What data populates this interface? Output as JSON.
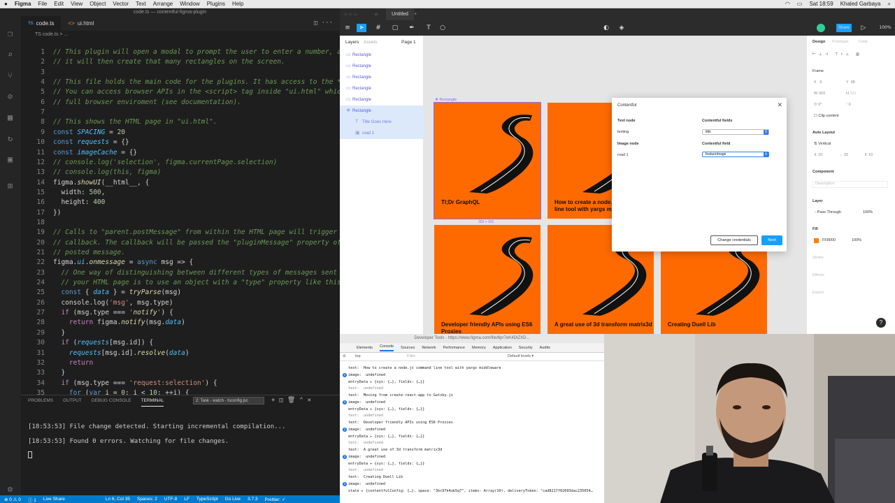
{
  "menubar": {
    "app": "Figma",
    "items": [
      "File",
      "Edit",
      "View",
      "Object",
      "Vector",
      "Text",
      "Arrange",
      "Window",
      "Plugins",
      "Help"
    ],
    "clock": "Sat 18:59",
    "user": "Khaled Garbaya"
  },
  "vscode": {
    "window_title": "code.ts — contentful-figma-plugin",
    "tabs": [
      {
        "badge": "TS",
        "label": "code.ts"
      },
      {
        "badge": "<>",
        "label": "ui.html"
      }
    ],
    "breadcrumb": "TS code.ts > ...",
    "code_lines": [
      {
        "n": "1",
        "t": "// This plugin will open a modal to prompt the user to enter a number, and"
      },
      {
        "n": "2",
        "t": "// it will then create that many rectangles on the screen."
      },
      {
        "n": "3",
        "t": ""
      },
      {
        "n": "4",
        "t": "// This file holds the main code for the plugins. It has access to the *doc"
      },
      {
        "n": "5",
        "t": "// You can access browser APIs in the <script> tag inside \"ui.html\" which"
      },
      {
        "n": "6",
        "t": "// full browser enviroment (see documentation)."
      },
      {
        "n": "7",
        "t": ""
      },
      {
        "n": "8",
        "t": "// This shows the HTML page in \"ui.html\"."
      },
      {
        "n": "9",
        "t": "const SPACING = 20"
      },
      {
        "n": "10",
        "t": "const requests = {}"
      },
      {
        "n": "11",
        "t": "const imageCache = {}"
      },
      {
        "n": "12",
        "t": "// console.log('selection', figma.currentPage.selection)"
      },
      {
        "n": "13",
        "t": "// console.log(this, figma)"
      },
      {
        "n": "14",
        "t": "figma.showUI(__html__, {"
      },
      {
        "n": "15",
        "t": "  width: 500,"
      },
      {
        "n": "16",
        "t": "  height: 400"
      },
      {
        "n": "17",
        "t": "})"
      },
      {
        "n": "18",
        "t": ""
      },
      {
        "n": "19",
        "t": "// Calls to \"parent.postMessage\" from within the HTML page will trigger th"
      },
      {
        "n": "20",
        "t": "// callback. The callback will be passed the \"pluginMessage\" property of"
      },
      {
        "n": "21",
        "t": "// posted message."
      },
      {
        "n": "22",
        "t": "figma.ui.onmessage = async msg => {"
      },
      {
        "n": "23",
        "t": "  // One way of distinguishing between different types of messages sent"
      },
      {
        "n": "24",
        "t": "  // your HTML page is to use an object with a \"type\" property like this"
      },
      {
        "n": "25",
        "t": "  const { data } = tryParse(msg)"
      },
      {
        "n": "26",
        "t": "  console.log('msg', msg.type)"
      },
      {
        "n": "27",
        "t": "  if (msg.type === 'notify') {"
      },
      {
        "n": "28",
        "t": "    return figma.notify(msg.data)"
      },
      {
        "n": "29",
        "t": "  }"
      },
      {
        "n": "30",
        "t": "  if (requests[msg.id]) {"
      },
      {
        "n": "31",
        "t": "    requests[msg.id].resolve(data)"
      },
      {
        "n": "32",
        "t": "    return"
      },
      {
        "n": "33",
        "t": "  }"
      },
      {
        "n": "34",
        "t": "  if (msg.type === 'request:selection') {"
      },
      {
        "n": "35",
        "t": "    for (var i = 0; i < 10; ++i) {"
      }
    ],
    "panel_tabs": [
      "PROBLEMS",
      "OUTPUT",
      "DEBUG CONSOLE",
      "TERMINAL"
    ],
    "task_select": "2: Task - watch - tsconfig.jsc",
    "terminal": [
      "[18:53:53] File change detected. Starting incremental compilation...",
      "",
      "[18:53:53] Found 0 errors. Watching for file changes."
    ],
    "status": [
      "⊗ 0 ⚠ 0",
      "ⓘ 1",
      "Live Share",
      "Ln 6, Col 35",
      "Spaces: 2",
      "UTF-8",
      "LF",
      "TypeScript",
      "Go Live",
      "3.7.3",
      "Prettier: ✓"
    ]
  },
  "figma": {
    "doc_tab": "Untitled",
    "share_label": "Share",
    "zoom": "100%",
    "panel_tabs": {
      "layers": "Layers",
      "assets": "Assets",
      "page": "Page 1"
    },
    "layers": [
      {
        "label": "Rectangle",
        "sel": false,
        "sub": false
      },
      {
        "label": "Rectangle",
        "sel": false,
        "sub": false
      },
      {
        "label": "Rectangle",
        "sel": false,
        "sub": false
      },
      {
        "label": "Rectangle",
        "sel": false,
        "sub": false
      },
      {
        "label": "Rectangle",
        "sel": false,
        "sub": false
      },
      {
        "label": "Rectangle",
        "sel": true,
        "sub": false
      },
      {
        "label": "Title Goes Here",
        "sel": true,
        "sub": true
      },
      {
        "label": "road 1",
        "sel": true,
        "sub": true
      }
    ],
    "canvas": {
      "selection_label": "Rectangle",
      "size_label": "303 × 331",
      "cards": [
        "Tl;Dr GraphQL",
        "How to create a node.js command line tool with yargs middleware",
        "Developer friendly APIs using ES6 Proxies",
        "A great use of 3d transform matrix3d",
        "Creating Duell Lib"
      ]
    },
    "modal": {
      "title": "Contentful",
      "col1_header": "Text node",
      "col2_header": "Contentful fields",
      "text_node": "texting",
      "text_field": "title",
      "image_header": "Image node",
      "image_field_header": "Contentful field",
      "image_node": "road 1",
      "image_field": "featureImage",
      "change_credentials": "Change credentials",
      "next": "Next"
    },
    "properties": {
      "tabs": [
        "Design",
        "Prototype",
        "Code"
      ],
      "frame_label": "Frame",
      "x": "-5",
      "y": "88",
      "w": "303",
      "h": "331",
      "rotation": "0°",
      "radius": "0",
      "clip": "Clip content",
      "auto_layout": "Auto Layout",
      "direction": "Vertical",
      "spacing": "20",
      "padding_h": "25",
      "padding_v": "10",
      "component": "Component",
      "description": "Description",
      "layer": "Layer",
      "blend": "Pass Through",
      "opacity": "100%",
      "fill": "Fill",
      "fill_hex": "FF8000",
      "fill_opacity": "100%",
      "fill_color": "#ff8000",
      "stroke": "Stroke",
      "effects": "Effects",
      "export": "Export"
    }
  },
  "devtools": {
    "title": "Developer Tools - https://www.figma.com/file/6pr7eK4DtZXD...",
    "tabs": [
      "Elements",
      "Console",
      "Sources",
      "Network",
      "Performance",
      "Memory",
      "Application",
      "Security",
      "Audits"
    ],
    "context": "top",
    "filter_placeholder": "Filter",
    "levels": "Default levels ▾",
    "lines": [
      {
        "b": "",
        "t": "text:  How to create a node.js command line tool with yargs middleware",
        "u": false
      },
      {
        "b": "2",
        "t": "image:  undefined",
        "u": false
      },
      {
        "b": "",
        "t": "entryData ▸ {sys: {…}, fields: {…}}",
        "u": false
      },
      {
        "b": "",
        "t": "text:  undefined",
        "u": true
      },
      {
        "b": "",
        "t": "text:  Moving from create-react-app to Gatsby.js",
        "u": false
      },
      {
        "b": "2",
        "t": "image:  undefined",
        "u": false
      },
      {
        "b": "",
        "t": "entryData ▸ {sys: {…}, fields: {…}}",
        "u": false
      },
      {
        "b": "",
        "t": "text:  undefined",
        "u": true
      },
      {
        "b": "",
        "t": "text:  Developer friendly APIs using ES6 Proxies",
        "u": false
      },
      {
        "b": "2",
        "t": "image:  undefined",
        "u": false
      },
      {
        "b": "",
        "t": "entryData ▸ {sys: {…}, fields: {…}}",
        "u": false
      },
      {
        "b": "",
        "t": "text:  undefined",
        "u": true
      },
      {
        "b": "",
        "t": "text:  A great use of 3d transform matrix3d",
        "u": false
      },
      {
        "b": "2",
        "t": "image:  undefined",
        "u": false
      },
      {
        "b": "",
        "t": "entryData ▸ {sys: {…}, fields: {…}}",
        "u": false
      },
      {
        "b": "",
        "t": "text:  undefined",
        "u": true
      },
      {
        "b": "",
        "t": "text:  Creating Duell Lib",
        "u": false
      },
      {
        "b": "2",
        "t": "image:  undefined",
        "u": false
      },
      {
        "b": "",
        "t": "state ▸ {contentfulConfig: {…}, space: \"3bc97k4uk5q7\", items: Array(10), deliveryToken: \"cad8217f02693dac235054…",
        "u": false
      }
    ]
  }
}
